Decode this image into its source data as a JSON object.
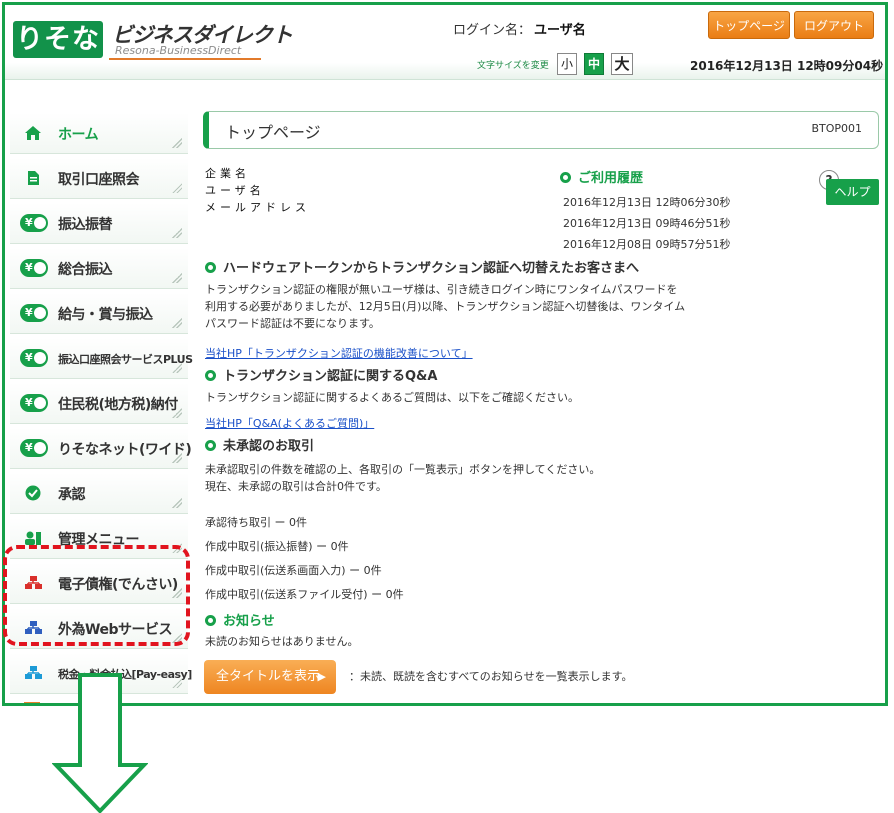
{
  "header": {
    "logo_mark": "りそな",
    "logo_name": "ビジネスダイレクト",
    "logo_sub": "Resona-BusinessDirect",
    "login_label": "ログイン名：",
    "login_user": "ユーザ名",
    "top_button": "トップページへ",
    "logout_button": "ログアウト",
    "font_size_label": "文字サイズを変更",
    "font_small": "小",
    "font_medium": "中",
    "font_large": "大",
    "datetime": "2016年12月13日  12時09分04秒"
  },
  "sidebar": {
    "items": [
      {
        "label": "ホーム",
        "icon": "home-icon"
      },
      {
        "label": "取引口座照会",
        "icon": "document-icon"
      },
      {
        "label": "振込振替",
        "icon": "transfer-icon"
      },
      {
        "label": "総合振込",
        "icon": "transfer-icon"
      },
      {
        "label": "給与・賞与振込",
        "icon": "transfer-icon"
      },
      {
        "label": "振込口座照会サービスPLUS",
        "icon": "transfer-icon"
      },
      {
        "label": "住民税(地方税)納付",
        "icon": "transfer-icon"
      },
      {
        "label": "りそなネット(ワイド)",
        "icon": "transfer-icon"
      },
      {
        "label": "承認",
        "icon": "check-icon"
      },
      {
        "label": "管理メニュー",
        "icon": "admin-icon"
      },
      {
        "label": "電子債権(でんさい)",
        "icon": "network-icon"
      },
      {
        "label": "外為Webサービス",
        "icon": "network-icon"
      },
      {
        "label": "税金・料金払込[Pay-easy]",
        "icon": "network-icon"
      }
    ]
  },
  "main": {
    "page_title": "トップページ",
    "page_code": "BTOP001",
    "info_labels": [
      "企業名",
      "ユーザ名",
      "メールアドレス"
    ],
    "history": {
      "title": "ご利用履歴",
      "entries": [
        "2016年12月13日  12時06分30秒",
        "2016年12月13日  09時46分51秒",
        "2016年12月08日  09時57分51秒"
      ]
    },
    "help_label": "ヘルプ",
    "help_q": "?",
    "hw_token": {
      "title": "ハードウェアトークンからトランザクション認証へ切替えたお客さまへ",
      "lines": [
        "トランザクション認証の権限が無いユーザ様は、引き続きログイン時にワンタイムパスワードを",
        "利用する必要がありましたが、12月5日(月)以降、トランザクション認証へ切替後は、ワンタイム",
        "パスワード認証は不要になります。"
      ],
      "link": "当社HP「トランザクション認証の機能改善について」"
    },
    "qa": {
      "title": "トランザクション認証に関するQ&A",
      "text": "トランザクション認証に関するよくあるご質問は、以下をご確認ください。",
      "link": "当社HP「Q&A(よくあるご質問)」"
    },
    "pending": {
      "title": "未承認のお取引",
      "lines": [
        "未承認取引の件数を確認の上、各取引の「一覧表示」ボタンを押してください。",
        "現在、未承認の取引は合計0件です。"
      ],
      "items": [
        "承認待ち取引 ー 0件",
        "作成中取引(振込振替) ー 0件",
        "作成中取引(伝送系画面入力) ー 0件",
        "作成中取引(伝送系ファイル受付) ー 0件"
      ]
    },
    "notice": {
      "title": "お知らせ",
      "text": "未読のお知らせはありません。",
      "button": "全タイトルを表示",
      "button_arrow": "▶",
      "desc": "：未読、既読を含むすべてのお知らせを一覧表示します。"
    }
  },
  "colors": {
    "brand_green": "#17a04a",
    "accent_orange": "#ee8521",
    "highlight_red": "#e1141e"
  }
}
